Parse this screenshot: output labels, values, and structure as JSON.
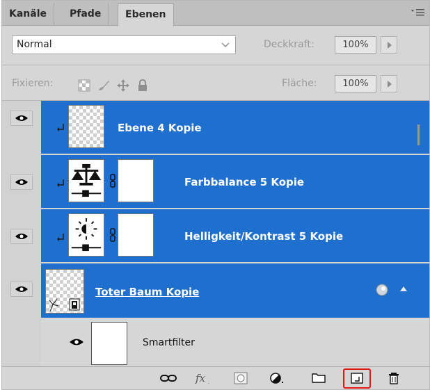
{
  "tabs": [
    {
      "label": "Kanäle"
    },
    {
      "label": "Pfade"
    },
    {
      "label": "Ebenen"
    }
  ],
  "blend_mode": {
    "value": "Normal"
  },
  "opacity": {
    "label": "Deckkraft:",
    "value": "100%"
  },
  "lock": {
    "label": "Fixieren:"
  },
  "fill": {
    "label": "Fläche:",
    "value": "100%"
  },
  "layers": [
    {
      "name": "Ebene 4 Kopie"
    },
    {
      "name": "Farbbalance 5 Kopie"
    },
    {
      "name": "Helligkeit/Kontrast 5 Kopie"
    },
    {
      "name": "Toter Baum Kopie"
    },
    {
      "name": "Smartfilter"
    }
  ],
  "colors": {
    "selection": "#1f6fce",
    "panel": "#d6d6d6",
    "highlight": "#e01818"
  },
  "icons": {
    "panel_menu": "panel-menu-icon",
    "footer": [
      "link-layers-icon",
      "fx-icon",
      "add-mask-icon",
      "adjustment-layer-icon",
      "new-group-icon",
      "new-layer-icon",
      "delete-icon"
    ]
  }
}
